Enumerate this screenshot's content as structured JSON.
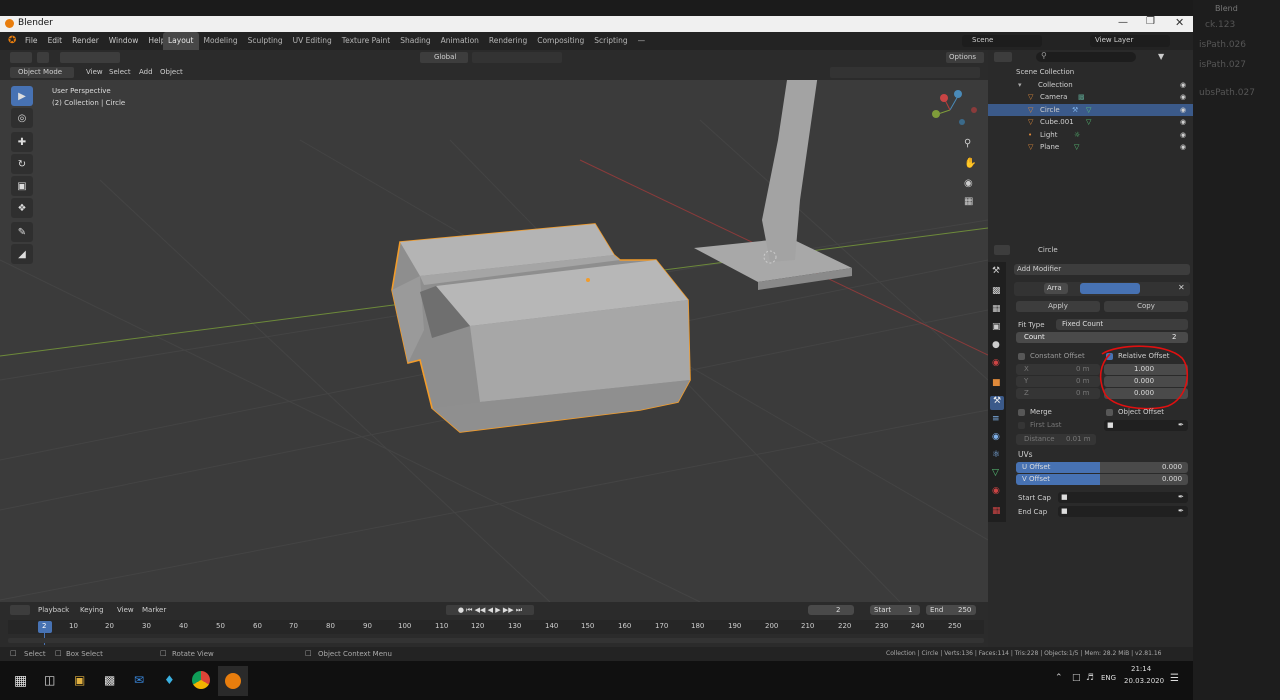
{
  "window": {
    "title": "Blender"
  },
  "menubar": {
    "menus": [
      "File",
      "Edit",
      "Render",
      "Window",
      "Help"
    ],
    "workspaces": [
      "Layout",
      "Modeling",
      "Sculpting",
      "UV Editing",
      "Texture Paint",
      "Shading",
      "Animation",
      "Rendering",
      "Compositing",
      "Scripting"
    ],
    "active_workspace": "Layout",
    "scene_label": "Scene",
    "view_layer_label": "View Layer"
  },
  "viewport_header": {
    "mode": "Object Mode",
    "menus": [
      "View",
      "Select",
      "Add",
      "Object"
    ],
    "transform": "Global",
    "options": "Options"
  },
  "viewport": {
    "overlay_line1": "User Perspective",
    "overlay_line2": "(2) Collection | Circle",
    "gizmo_axes": {
      "x": "X",
      "y": "Y",
      "z": "Z"
    }
  },
  "outliner": {
    "rows": [
      {
        "label": "Scene Collection",
        "indent": 0,
        "selected": false
      },
      {
        "label": "Collection",
        "indent": 1,
        "selected": false
      },
      {
        "label": "Camera",
        "indent": 2,
        "selected": false
      },
      {
        "label": "Circle",
        "indent": 2,
        "selected": true
      },
      {
        "label": "Cube.001",
        "indent": 2,
        "selected": false
      },
      {
        "label": "Light",
        "indent": 2,
        "selected": false
      },
      {
        "label": "Plane",
        "indent": 2,
        "selected": false
      }
    ]
  },
  "properties": {
    "object_name": "Circle",
    "add_modifier": "Add Modifier",
    "modifier_name": "Arra",
    "apply": "Apply",
    "copy": "Copy",
    "fit_type_label": "Fit Type",
    "fit_type_value": "Fixed Count",
    "count_label": "Count",
    "count_value": "2",
    "constant_offset": "Constant Offset",
    "relative_offset": "Relative Offset",
    "const_x_label": "X",
    "const_x_value": "0 m",
    "const_y_label": "Y",
    "const_y_value": "0 m",
    "const_z_label": "Z",
    "const_z_value": "0 m",
    "rel_x_value": "1.000",
    "rel_y_value": "0.000",
    "rel_z_value": "0.000",
    "merge": "Merge",
    "first_last": "First Last",
    "distance_label": "Distance",
    "distance_value": "0.01 m",
    "object_offset": "Object Offset",
    "uvs": "UVs",
    "u_offset_label": "U Offset",
    "u_offset_value": "0.000",
    "v_offset_label": "V Offset",
    "v_offset_value": "0.000",
    "start_cap": "Start Cap",
    "end_cap": "End Cap"
  },
  "timeline": {
    "playback": "Playback",
    "keying": "Keying",
    "view": "View",
    "marker": "Marker",
    "current_frame": "2",
    "start_label": "Start",
    "start_value": "1",
    "end_label": "End",
    "end_value": "250",
    "ticks": [
      "2",
      "10",
      "20",
      "30",
      "40",
      "50",
      "60",
      "70",
      "80",
      "90",
      "100",
      "110",
      "120",
      "130",
      "140",
      "150",
      "160",
      "170",
      "180",
      "190",
      "200",
      "210",
      "220",
      "230",
      "240",
      "250"
    ]
  },
  "statusbar": {
    "select": "Select",
    "box_select": "Box Select",
    "rotate_view": "Rotate View",
    "context_menu": "Object Context Menu",
    "stats": "Collection | Circle | Verts:136 | Faces:114 | Tris:228 | Objects:1/5 | Mem: 28.2 MiB | v2.81.16"
  },
  "taskbar": {
    "language": "ENG",
    "time": "21:14",
    "date": "20.03.2020"
  },
  "right_column_text": [
    "Blend",
    "ck.123",
    "isPath.026",
    "isPath.027",
    "ubsPath.027"
  ],
  "colors": {
    "accent": "#4772b3",
    "selection_outline": "#f29c2b",
    "annotation": "#e01010"
  }
}
